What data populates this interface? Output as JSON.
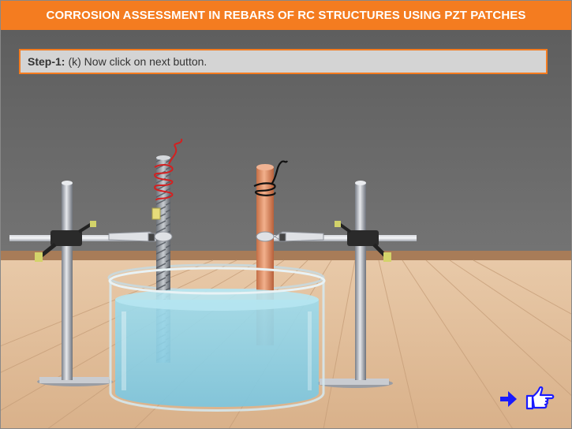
{
  "header": {
    "title": "CORROSION ASSESSMENT IN REBARS OF RC STRUCTURES USING PZT PATCHES"
  },
  "instruction": {
    "step": "Step-1:",
    "text": "(k) Now click on next button."
  },
  "colors": {
    "accent": "#f47c20",
    "nav_blue": "#1a1aff",
    "water": "#8fd3e6",
    "copper": "#e0926a"
  },
  "nav": {
    "next_arrow_icon": "right-arrow-icon",
    "next_hand_icon": "pointing-hand-icon"
  }
}
